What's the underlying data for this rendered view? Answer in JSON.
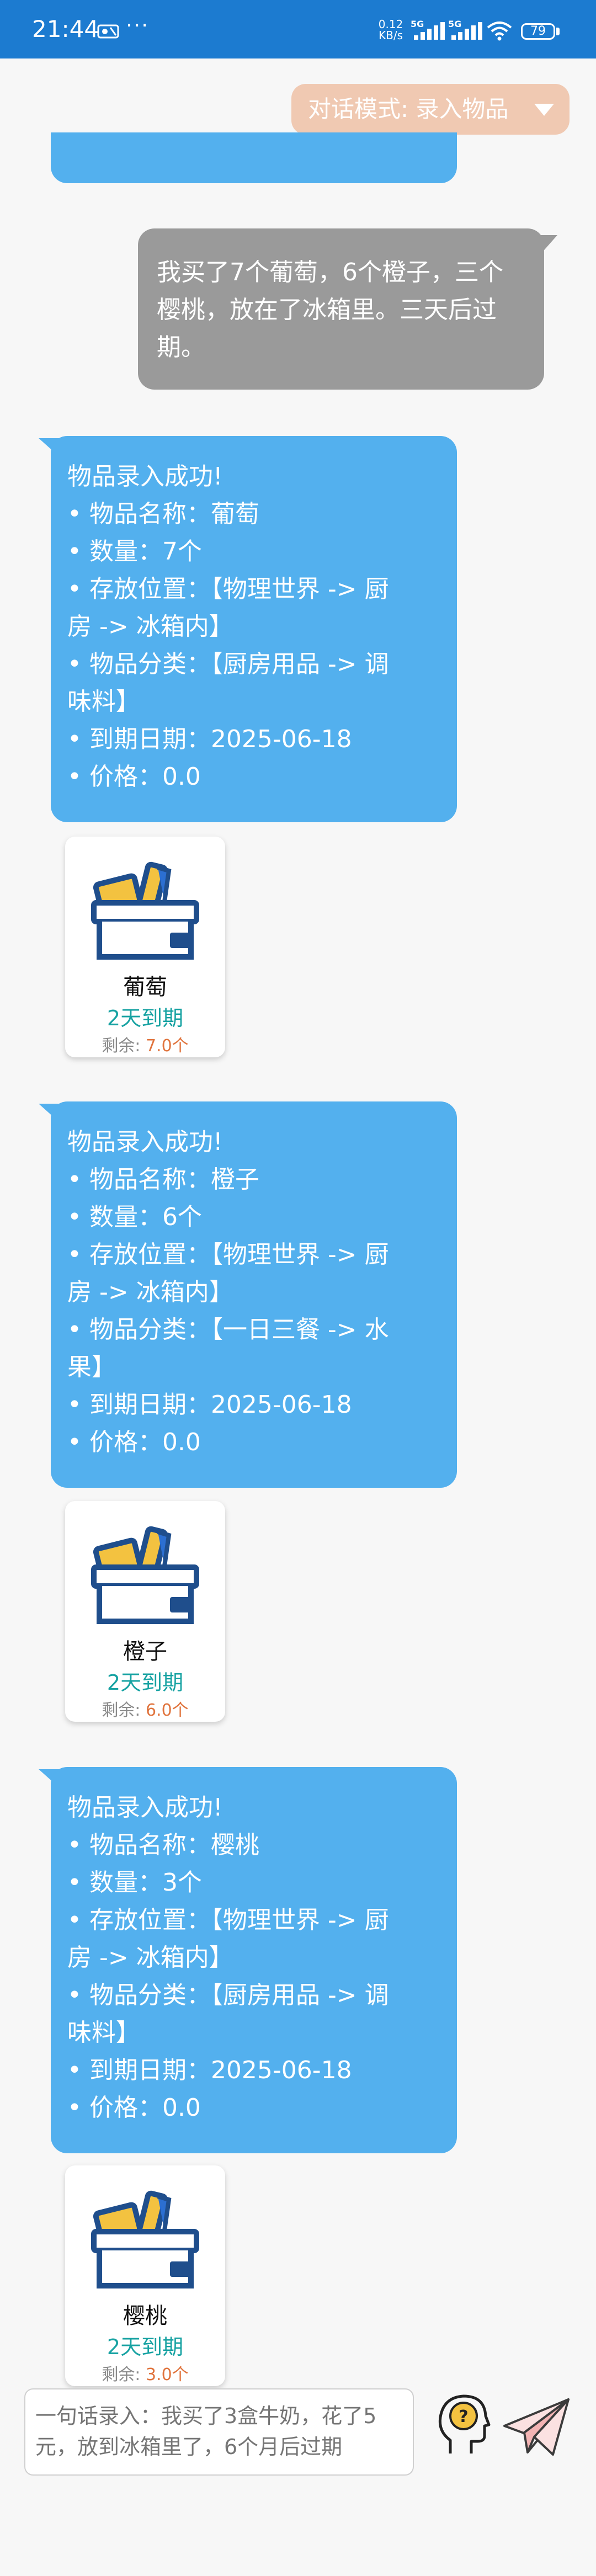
{
  "status_bar": {
    "time": "21:44",
    "dots": "···",
    "net_speed_value": "0.12",
    "net_speed_unit": "KB/s",
    "sig1_label": "5G",
    "sig2_label": "5G",
    "battery": "79"
  },
  "mode_selector": {
    "label": "对话模式: 录入物品"
  },
  "user_message": {
    "text": "我买了7个葡萄，6个橙子，三个樱桃，放在了冰箱里。三天后过期。"
  },
  "responses": [
    {
      "lines": [
        "物品录入成功!",
        "•  物品名称：葡萄",
        "•  数量：7个",
        "•  存放位置：【物理世界 -> 厨",
        "房 -> 冰箱内】",
        "•  物品分类：【厨房用品 -> 调",
        "味料】",
        "•  到期日期：2025-06-18",
        "•  价格：0.0"
      ],
      "card": {
        "name": "葡萄",
        "expire": "2天到期",
        "remain_label": "剩余:",
        "remain_qty": "7.0个"
      }
    },
    {
      "lines": [
        "物品录入成功!",
        "•  物品名称：橙子",
        "•  数量：6个",
        "•  存放位置：【物理世界 -> 厨",
        "房 -> 冰箱内】",
        "•  物品分类：【一日三餐 -> 水",
        "果】",
        "•  到期日期：2025-06-18",
        "•  价格：0.0"
      ],
      "card": {
        "name": "橙子",
        "expire": "2天到期",
        "remain_label": "剩余:",
        "remain_qty": "6.0个"
      }
    },
    {
      "lines": [
        "物品录入成功!",
        "•  物品名称：樱桃",
        "•  数量：3个",
        "•  存放位置：【物理世界 -> 厨",
        "房 -> 冰箱内】",
        "•  物品分类：【厨房用品 -> 调",
        "味料】",
        "•  到期日期：2025-06-18",
        "•  价格：0.0"
      ],
      "card": {
        "name": "樱桃",
        "expire": "2天到期",
        "remain_label": "剩余:",
        "remain_qty": "3.0个"
      }
    }
  ],
  "input": {
    "placeholder": "一句话录入：我买了3盒牛奶，花了5元，放到冰箱里了，6个月后过期"
  },
  "colors": {
    "status_bar": "#1c7bd0",
    "response_bubble": "#53b0ee",
    "user_bubble": "#9a9a9a",
    "mode_button": "#f0c9b2",
    "expire_text": "#17a2a2",
    "remain_qty": "#e0733c"
  },
  "icons": {
    "item_card": "wallet-box-icon",
    "think": "thinking-head-icon",
    "send": "paper-plane-icon",
    "mode_arrow": "triangle-down-icon"
  }
}
